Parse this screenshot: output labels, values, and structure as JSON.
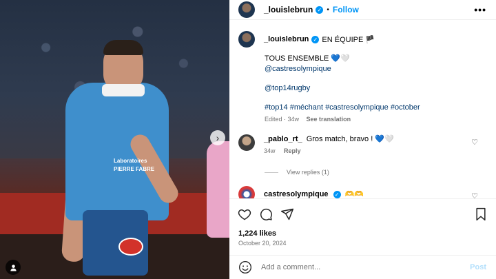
{
  "header": {
    "username": "_louislebrun",
    "separator": "•",
    "follow_label": "Follow",
    "more_label": "•••"
  },
  "caption": {
    "username": "_louislebrun",
    "suffix": "EN ÉQUIPE 🏴",
    "line1": "TOUS ENSEMBLE 💙🤍",
    "mention1": "@castresolympique",
    "mention2": "@top14rugby",
    "hashtags": "#top14 #méchant #castresolympique #october",
    "edited": "Edited · 34w",
    "see_translation": "See translation"
  },
  "comments": [
    {
      "username": "_pablo_rt_",
      "text": "Gros match, bravo ! 💙🤍",
      "age": "34w",
      "reply_label": "Reply",
      "view_replies": "View replies (1)"
    },
    {
      "username": "castresolympique",
      "text": "🫶🫶"
    }
  ],
  "post": {
    "likes": "1,224 likes",
    "date": "October 20, 2024",
    "add_comment_placeholder": "Add a comment...",
    "post_label": "Post"
  },
  "photo": {
    "jersey_sponsor": "Laboratoires PIERRE FABRE"
  },
  "icons": {
    "verified": "verified-badge-icon",
    "like": "heart-icon",
    "comment": "comment-bubble-icon",
    "share": "paper-plane-icon",
    "save": "bookmark-icon",
    "emoji": "smiley-icon",
    "next": "chevron-right-icon",
    "tag": "user-tag-icon"
  },
  "colors": {
    "accent": "#0095f6",
    "link": "#00376b",
    "muted": "#737373",
    "post_disabled": "#b2dffc"
  }
}
